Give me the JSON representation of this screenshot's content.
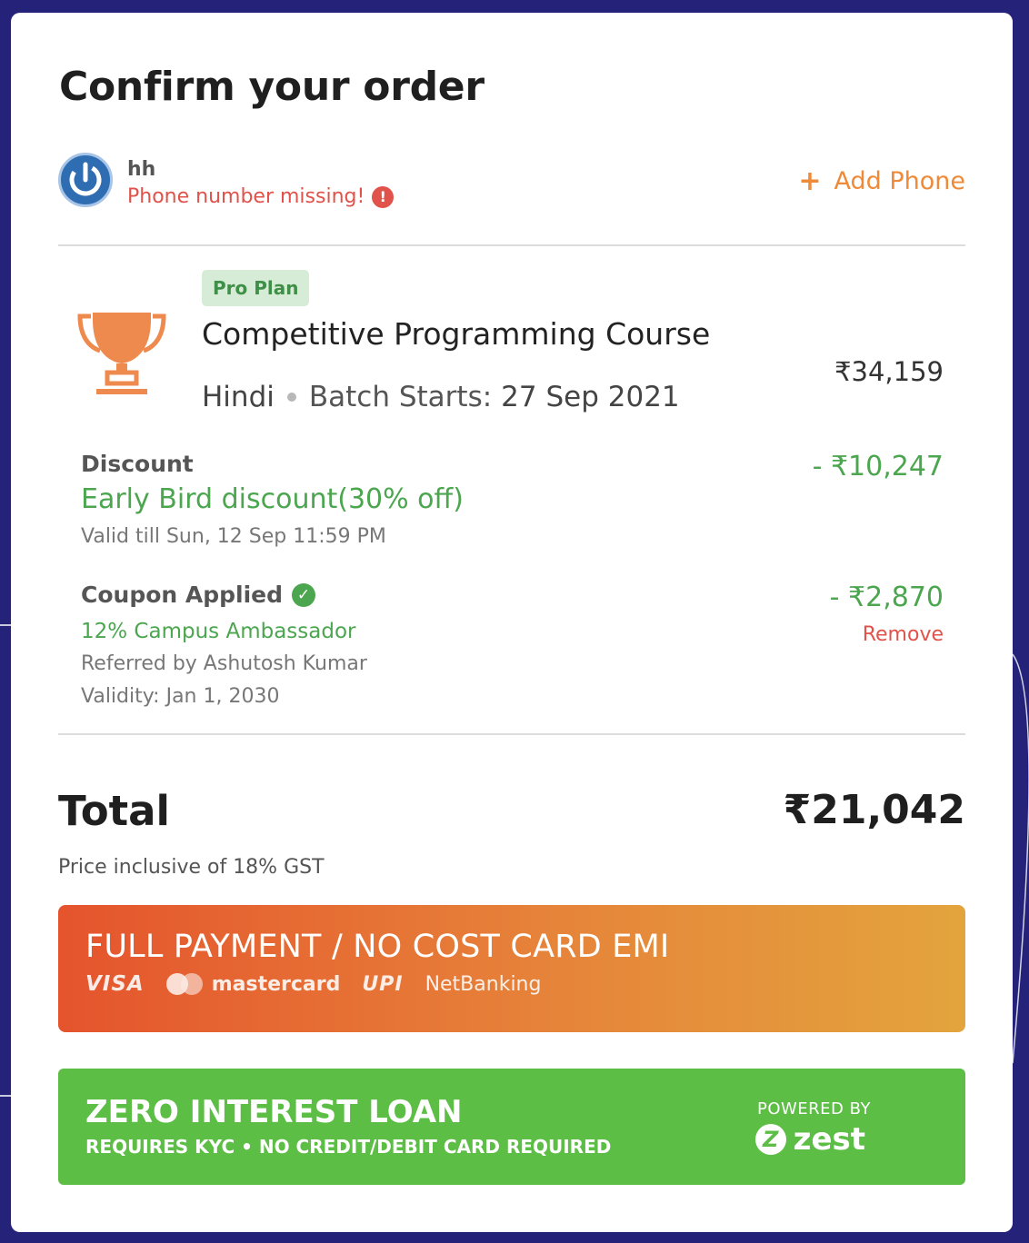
{
  "header": {
    "title": "Confirm your order"
  },
  "user": {
    "name": "hh",
    "phone_warning": "Phone number missing!",
    "warning_icon": "!",
    "add_phone_plus": "+",
    "add_phone_label": "Add Phone"
  },
  "course": {
    "badge": "Pro Plan",
    "title": "Competitive Programming Course",
    "language": "Hindi",
    "batch_label": "Batch Starts:",
    "batch_date": "27 Sep 2021",
    "price": "₹34,159"
  },
  "discount": {
    "label": "Discount",
    "name": "Early Bird discount(30% off)",
    "validity": "Valid till Sun, 12 Sep 11:59 PM",
    "amount": "- ₹10,247"
  },
  "coupon": {
    "label": "Coupon Applied",
    "check_icon": "✓",
    "name": "12% Campus Ambassador",
    "referred_by": "Referred by Ashutosh Kumar",
    "validity": "Validity: Jan 1, 2030",
    "amount": "- ₹2,870",
    "remove_label": "Remove"
  },
  "total": {
    "label": "Total",
    "amount": "₹21,042",
    "note": "Price inclusive of 18% GST"
  },
  "payment_full": {
    "label": "FULL PAYMENT / NO COST CARD EMI",
    "methods": {
      "visa": "VISA",
      "mastercard": "mastercard",
      "upi": "UPI",
      "netbanking": "NetBanking"
    }
  },
  "payment_loan": {
    "label": "ZERO INTEREST LOAN",
    "sub": "REQUIRES KYC • NO CREDIT/DEBIT CARD REQUIRED",
    "powered_by": "POWERED BY",
    "provider": "zest",
    "provider_mark": "Z"
  },
  "colors": {
    "accent_orange": "#ef8a38",
    "success_green": "#4ca64f",
    "error_red": "#e0524a",
    "loan_green": "#5cbe45",
    "background": "#25227a"
  },
  "icons": [
    "power-icon",
    "warning-icon",
    "plus-icon",
    "trophy-icon",
    "check-circle-icon",
    "mastercard-icon",
    "zest-logo-icon"
  ]
}
